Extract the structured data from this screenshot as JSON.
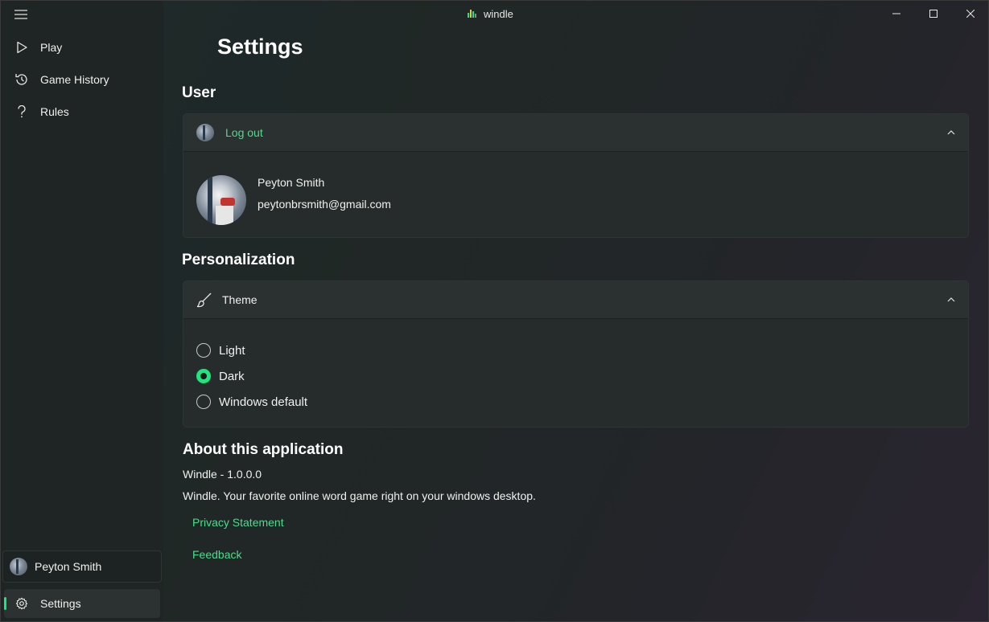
{
  "app": {
    "title": "windle"
  },
  "sidebar": {
    "items": [
      {
        "label": "Play",
        "icon": "play-icon"
      },
      {
        "label": "Game History",
        "icon": "history-icon"
      },
      {
        "label": "Rules",
        "icon": "question-icon"
      }
    ],
    "profile_name": "Peyton Smith",
    "settings_label": "Settings"
  },
  "page": {
    "title": "Settings"
  },
  "user": {
    "section_title": "User",
    "logout_label": "Log out",
    "name": "Peyton Smith",
    "email": "peytonbrsmith@gmail.com"
  },
  "personalization": {
    "section_title": "Personalization",
    "theme_label": "Theme",
    "options": [
      "Light",
      "Dark",
      "Windows default"
    ],
    "selected": "Dark"
  },
  "about": {
    "section_title": "About this application",
    "version": "Windle - 1.0.0.0",
    "description": "Windle. Your favorite online word game right on your windows desktop.",
    "privacy_label": "Privacy Statement",
    "feedback_label": "Feedback"
  },
  "colors": {
    "accent": "#1ce67d",
    "link": "#4ddc8c"
  }
}
